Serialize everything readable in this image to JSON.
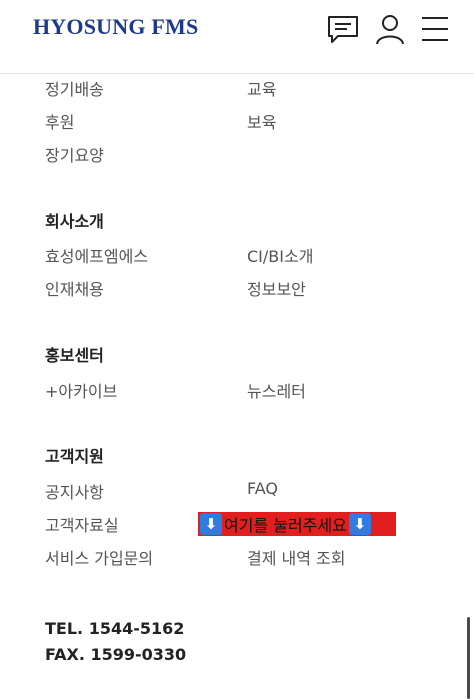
{
  "header": {
    "logo_text": "HYOSUNG FMS",
    "icons": [
      "chat-icon",
      "user-icon",
      "menu-icon"
    ]
  },
  "top_links": {
    "left": [
      "정기배송",
      "후원",
      "장기요양"
    ],
    "right": [
      "교육",
      "보육"
    ]
  },
  "company": {
    "title": "회사소개",
    "left": [
      "효성에프엠에스",
      "인재채용"
    ],
    "right": [
      "CI/BI소개",
      "정보보안"
    ]
  },
  "pr": {
    "title": "홍보센터",
    "left": [
      "+아카이브"
    ],
    "right": [
      "뉴스레터"
    ]
  },
  "support": {
    "title": "고객지원",
    "left": [
      "공지사항",
      "고객자료실",
      "서비스 가입문의"
    ],
    "right_faq": "FAQ",
    "highlight_text": "여기를 눌러주세요",
    "highlight_arrow": "⬇",
    "right_payment": "결제 내역 조회"
  },
  "contact": {
    "tel": "TEL. 1544-5162",
    "fax": "FAX. 1599-0330"
  },
  "colors": {
    "brand": "#1d3a8a",
    "highlight_bg": "#e21f1f",
    "arrow_bg": "#2f7de0"
  }
}
